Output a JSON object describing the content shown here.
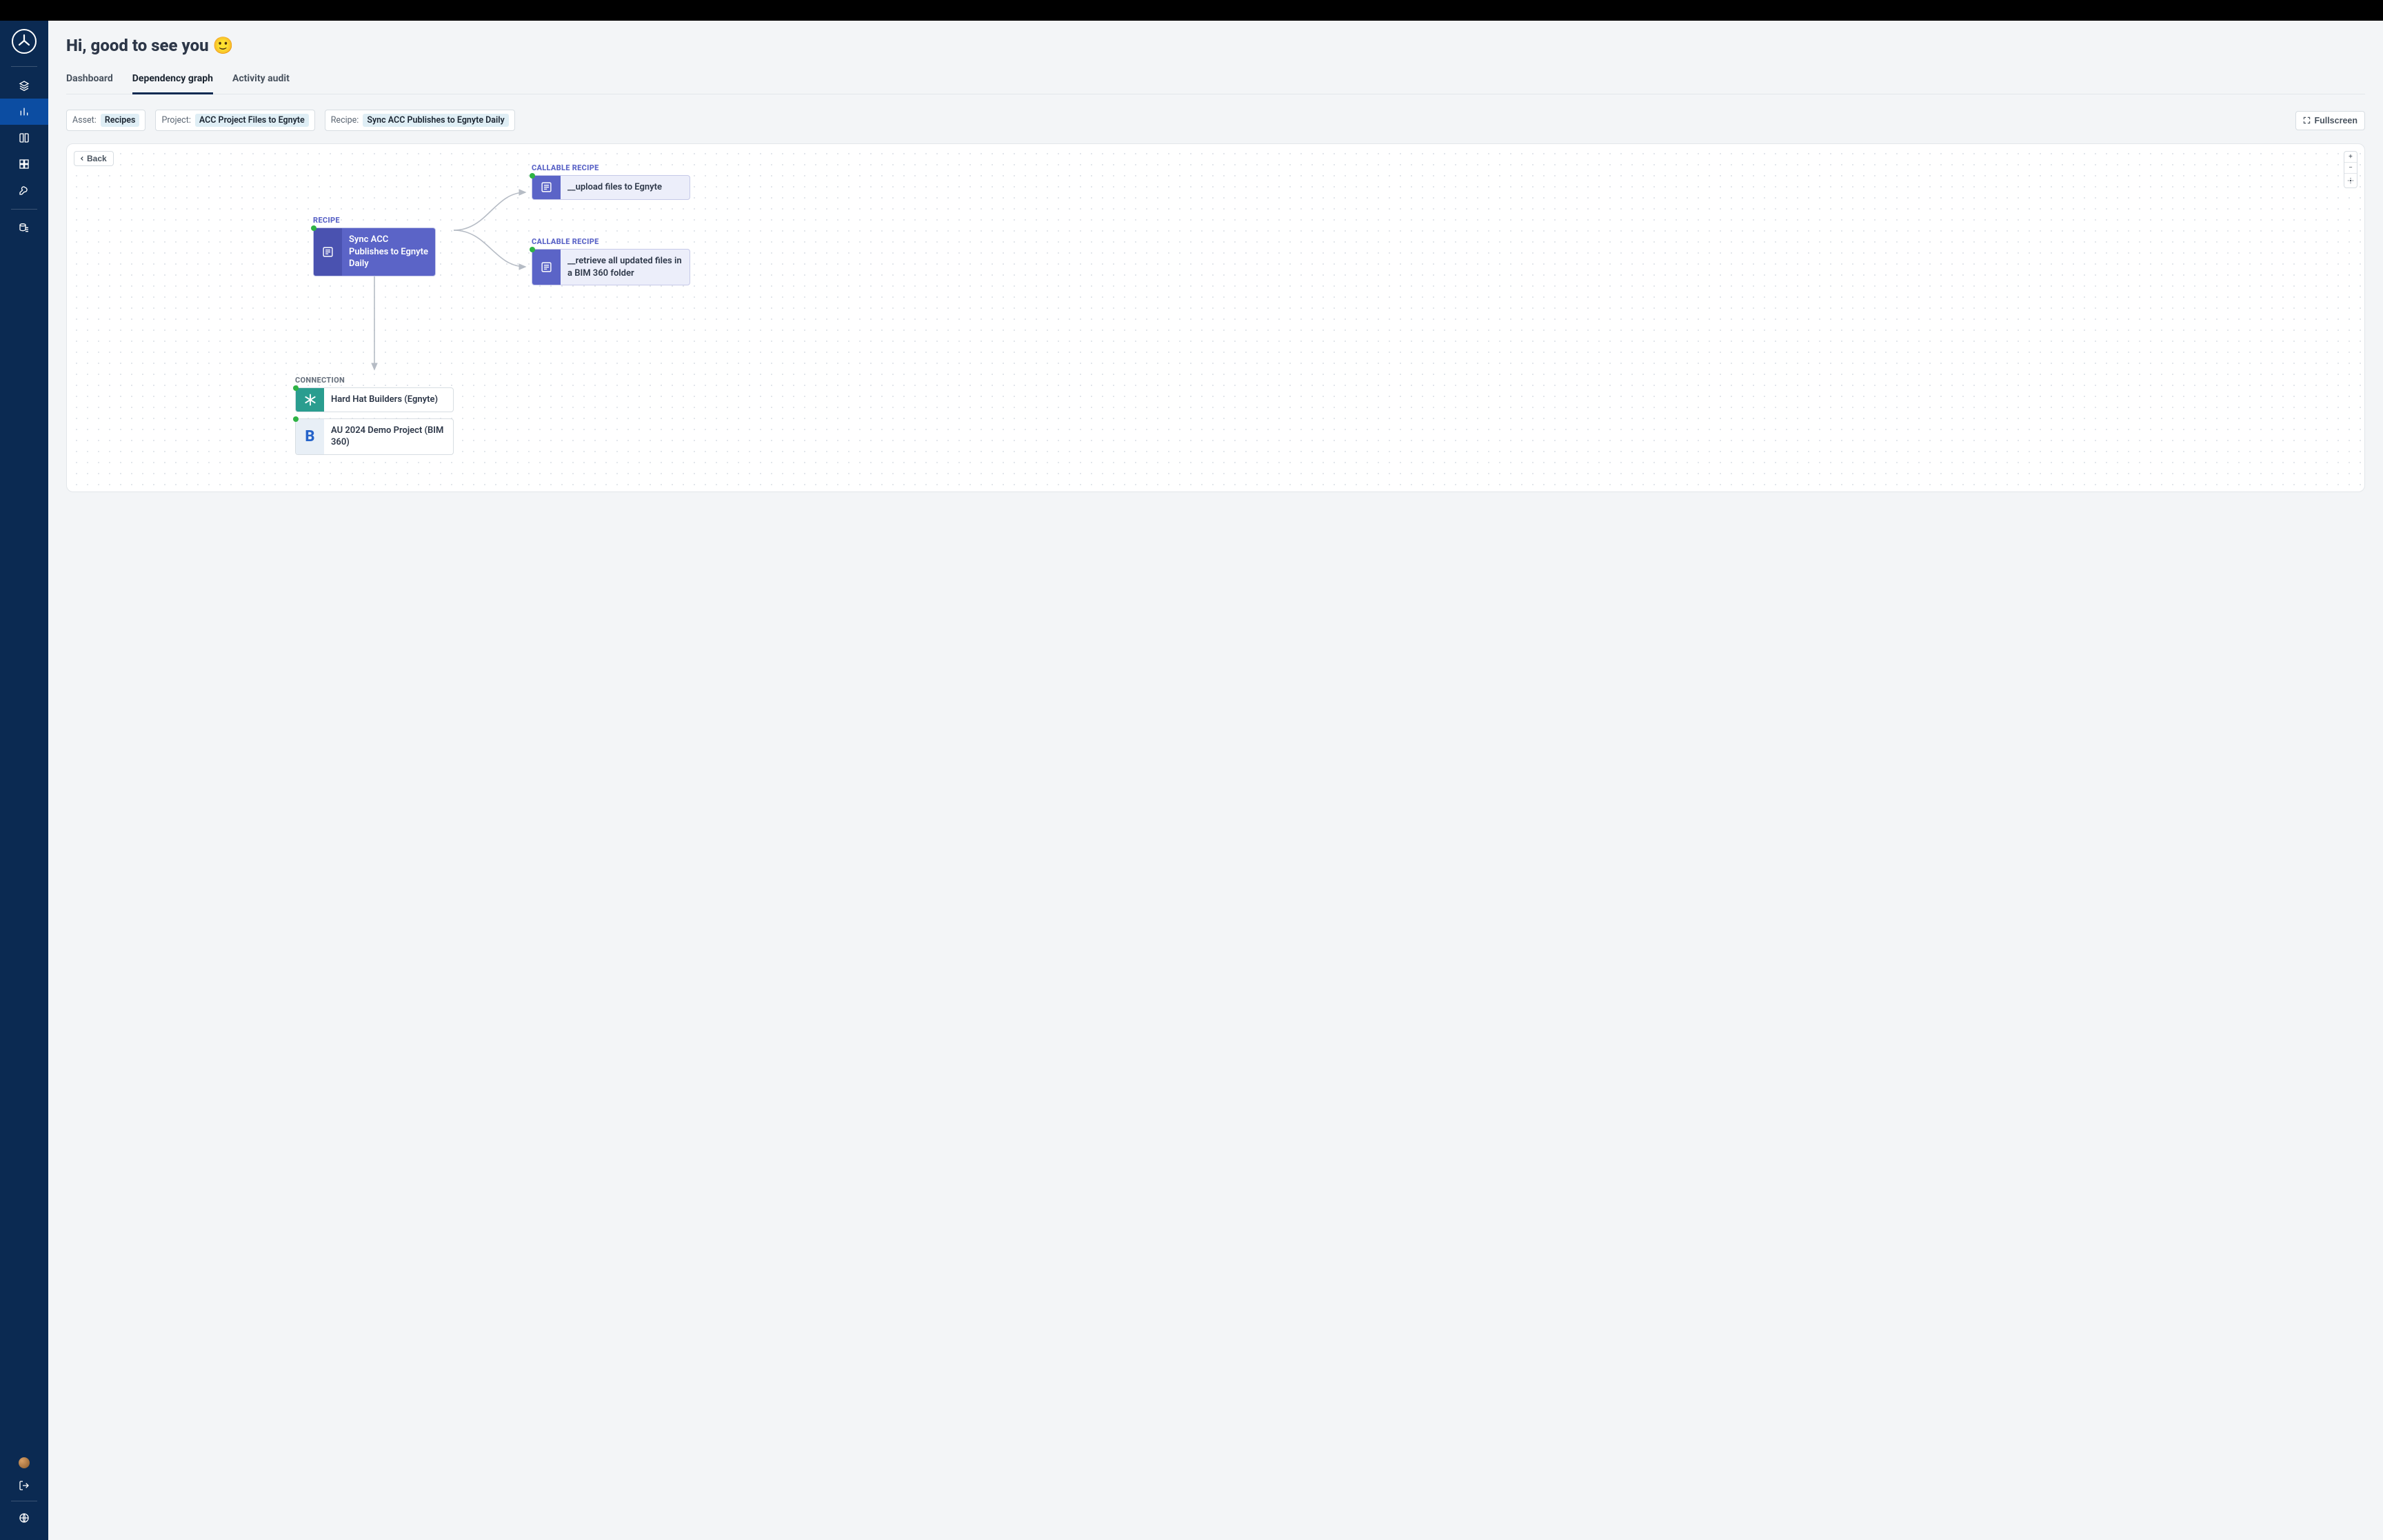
{
  "header": {
    "title": "Hi, good to see you 🙂"
  },
  "tabs": [
    {
      "label": "Dashboard",
      "active": false
    },
    {
      "label": "Dependency graph",
      "active": true
    },
    {
      "label": "Activity audit",
      "active": false
    }
  ],
  "filters": {
    "asset_label": "Asset:",
    "asset_value": "Recipes",
    "project_label": "Project:",
    "project_value": "ACC Project Files to Egnyte",
    "recipe_label": "Recipe:",
    "recipe_value": "Sync ACC Publishes to Egnyte Daily",
    "fullscreen_label": "Fullscreen"
  },
  "canvas": {
    "back_label": "Back",
    "nodes": {
      "main": {
        "type_label": "RECIPE",
        "title": "Sync ACC Publishes to Egnyte Daily"
      },
      "callable1": {
        "type_label": "CALLABLE RECIPE",
        "title": "__upload files to Egnyte"
      },
      "callable2": {
        "type_label": "CALLABLE RECIPE",
        "title": "__retrieve all updated files in a BIM 360 folder"
      },
      "connection_label": "CONNECTION",
      "conn1": {
        "title": "Hard Hat Builders (Egnyte)",
        "icon": "egnyte",
        "color": "#2a9d8f"
      },
      "conn2": {
        "title": "AU 2024 Demo Project (BIM 360)",
        "icon": "bim360",
        "color": "#e8eff6",
        "text_color": "#2563c9"
      }
    }
  }
}
